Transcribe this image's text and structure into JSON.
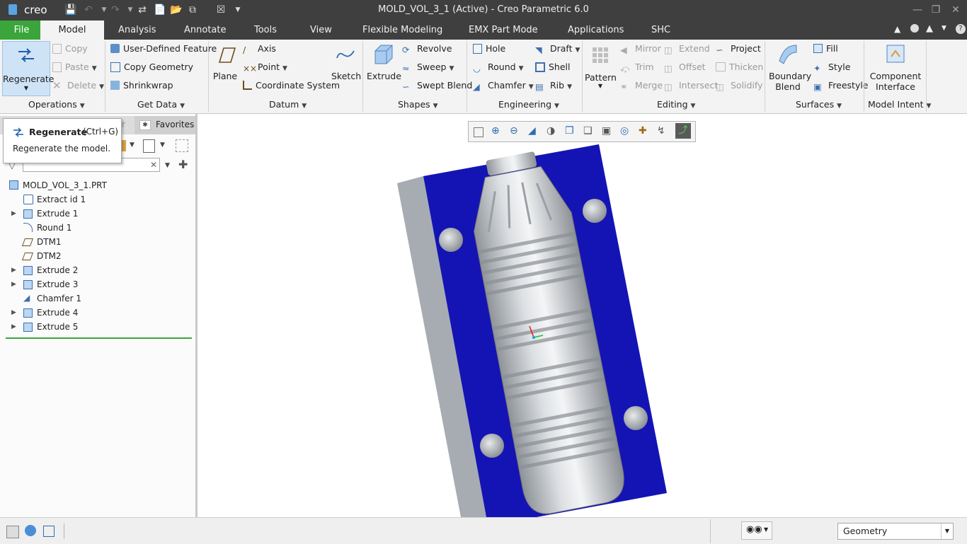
{
  "window": {
    "app_logo": "creo",
    "title": "MOLD_VOL_3_1 (Active) - Creo Parametric 6.0"
  },
  "tabs": [
    {
      "label": "File"
    },
    {
      "label": "Model"
    },
    {
      "label": "Analysis"
    },
    {
      "label": "Annotate"
    },
    {
      "label": "Tools"
    },
    {
      "label": "View"
    },
    {
      "label": "Flexible Modeling"
    },
    {
      "label": "EMX Part Mode"
    },
    {
      "label": "Applications"
    },
    {
      "label": "SHC"
    }
  ],
  "ribbon": {
    "operations": {
      "regenerate": "Regenerate",
      "copy": "Copy",
      "paste": "Paste",
      "delete": "Delete",
      "group": "Operations"
    },
    "get_data": {
      "udf": "User-Defined Feature",
      "copy_geometry": "Copy Geometry",
      "shrinkwrap": "Shrinkwrap",
      "group": "Get Data"
    },
    "datum": {
      "plane": "Plane",
      "axis": "Axis",
      "point": "Point",
      "csys": "Coordinate System",
      "sketch": "Sketch",
      "group": "Datum"
    },
    "shapes": {
      "extrude": "Extrude",
      "revolve": "Revolve",
      "sweep": "Sweep",
      "swept_blend": "Swept Blend",
      "group": "Shapes"
    },
    "engineering": {
      "hole": "Hole",
      "round": "Round",
      "chamfer": "Chamfer",
      "draft": "Draft",
      "shell": "Shell",
      "rib": "Rib",
      "group": "Engineering"
    },
    "editing": {
      "pattern": "Pattern",
      "mirror": "Mirror",
      "trim": "Trim",
      "merge": "Merge",
      "extend": "Extend",
      "offset": "Offset",
      "intersect": "Intersect",
      "project": "Project",
      "thicken": "Thicken",
      "solidify": "Solidify",
      "group": "Editing"
    },
    "surfaces": {
      "boundary_blend_1": "Boundary",
      "boundary_blend_2": "Blend",
      "fill": "Fill",
      "style": "Style",
      "freestyle": "Freestyle",
      "group": "Surfaces"
    },
    "model_intent": {
      "component_interface_1": "Component",
      "component_interface_2": "Interface",
      "group": "Model Intent"
    }
  },
  "tooltip": {
    "title": "Regenerate",
    "shortcut": "(Ctrl+G)",
    "description": "Regenerate the model."
  },
  "panel": {
    "tab_partial": "r",
    "favorites": "Favorites",
    "search_value": "",
    "tree": [
      {
        "label": "MOLD_VOL_3_1.PRT",
        "icon": "part-icon",
        "expandable": false,
        "root": true
      },
      {
        "label": "Extract id 1",
        "icon": "extract-icon",
        "expandable": false
      },
      {
        "label": "Extrude 1",
        "icon": "extrude-icon",
        "expandable": true
      },
      {
        "label": "Round 1",
        "icon": "round-icon",
        "expandable": false
      },
      {
        "label": "DTM1",
        "icon": "datum-plane-icon",
        "expandable": false
      },
      {
        "label": "DTM2",
        "icon": "datum-plane-icon",
        "expandable": false
      },
      {
        "label": "Extrude 2",
        "icon": "extrude-icon",
        "expandable": true
      },
      {
        "label": "Extrude 3",
        "icon": "extrude-icon",
        "expandable": true
      },
      {
        "label": "Chamfer 1",
        "icon": "chamfer-icon",
        "expandable": false
      },
      {
        "label": "Extrude 4",
        "icon": "extrude-icon",
        "expandable": true
      },
      {
        "label": "Extrude 5",
        "icon": "extrude-icon",
        "expandable": true
      }
    ]
  },
  "status": {
    "filter_value": "Geometry"
  },
  "colors": {
    "titlebar": "#3f3f40",
    "file_tab": "#3aa53a",
    "mold_blue": "#1414b4",
    "mold_gray": "#a6acb2"
  }
}
